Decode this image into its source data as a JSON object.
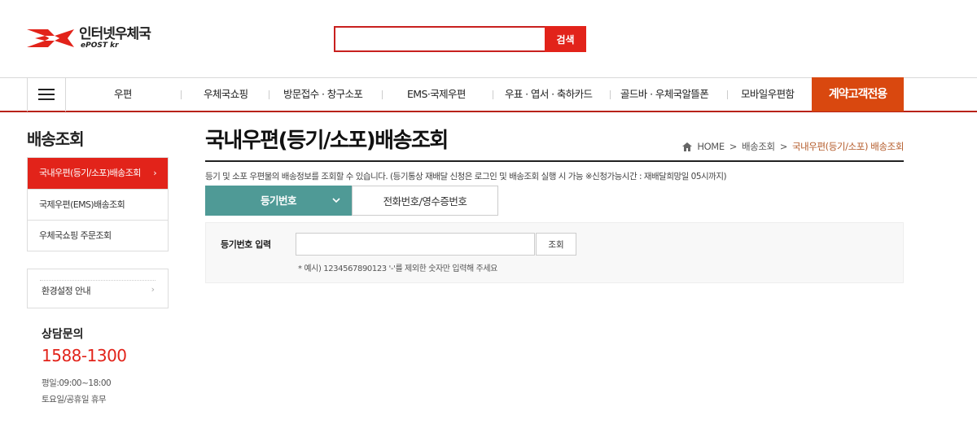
{
  "header": {
    "logo_kr": "인터넷우체국",
    "logo_en": "ePOST kr",
    "search_placeholder": "",
    "search_button": "검색",
    "brand_color": "#e2231a"
  },
  "nav": {
    "items": [
      {
        "label": "우편"
      },
      {
        "label": "우체국쇼핑"
      },
      {
        "label": "방문접수 · 창구소포"
      },
      {
        "label": "EMS·국제우편"
      },
      {
        "label": "우표 · 엽서 · 축하카드"
      },
      {
        "label": "골드바 · 우체국알뜰폰"
      },
      {
        "label": "모바일우편함"
      }
    ],
    "special": "계약고객전용",
    "special_color": "#d9480f"
  },
  "sidebar": {
    "title": "배송조회",
    "items": [
      {
        "label": "국내우편(등기/소포)배송조회",
        "active": true,
        "arrow": "›"
      },
      {
        "label": "국제우편(EMS)배송조회"
      },
      {
        "label": "우체국쇼핑 주문조회"
      }
    ],
    "env_label": "환경설정 안내",
    "env_arrow": "›",
    "consult_title": "상담문의",
    "consult_phone": "1588-1300",
    "hours_weekday": "평일:09:00~18:00",
    "hours_weekend": "토요일/공휴일 휴무"
  },
  "main": {
    "title": "국내우편(등기/소포)배송조회",
    "breadcrumb": {
      "home": "HOME",
      "level1": "배송조회",
      "current": "국내우편(등기/소포) 배송조회",
      "sep": ">"
    },
    "description": "등기 및 소포 우편물의 배송정보를 조회할 수 있습니다. (등기통상 재배달 신청은 로그인 및 배송조회 실행 시 가능 ※신청가능시간 : 재배달희망일 05시까지)",
    "tabs": [
      {
        "label": "등기번호",
        "active": true
      },
      {
        "label": "전화번호/영수증번호",
        "active": false
      }
    ],
    "form": {
      "label": "등기번호 입력",
      "input_value": "",
      "button": "조회",
      "hint": "* 예시) 1234567890123 '-'를 제외한 숫자만 입력해 주세요"
    }
  }
}
